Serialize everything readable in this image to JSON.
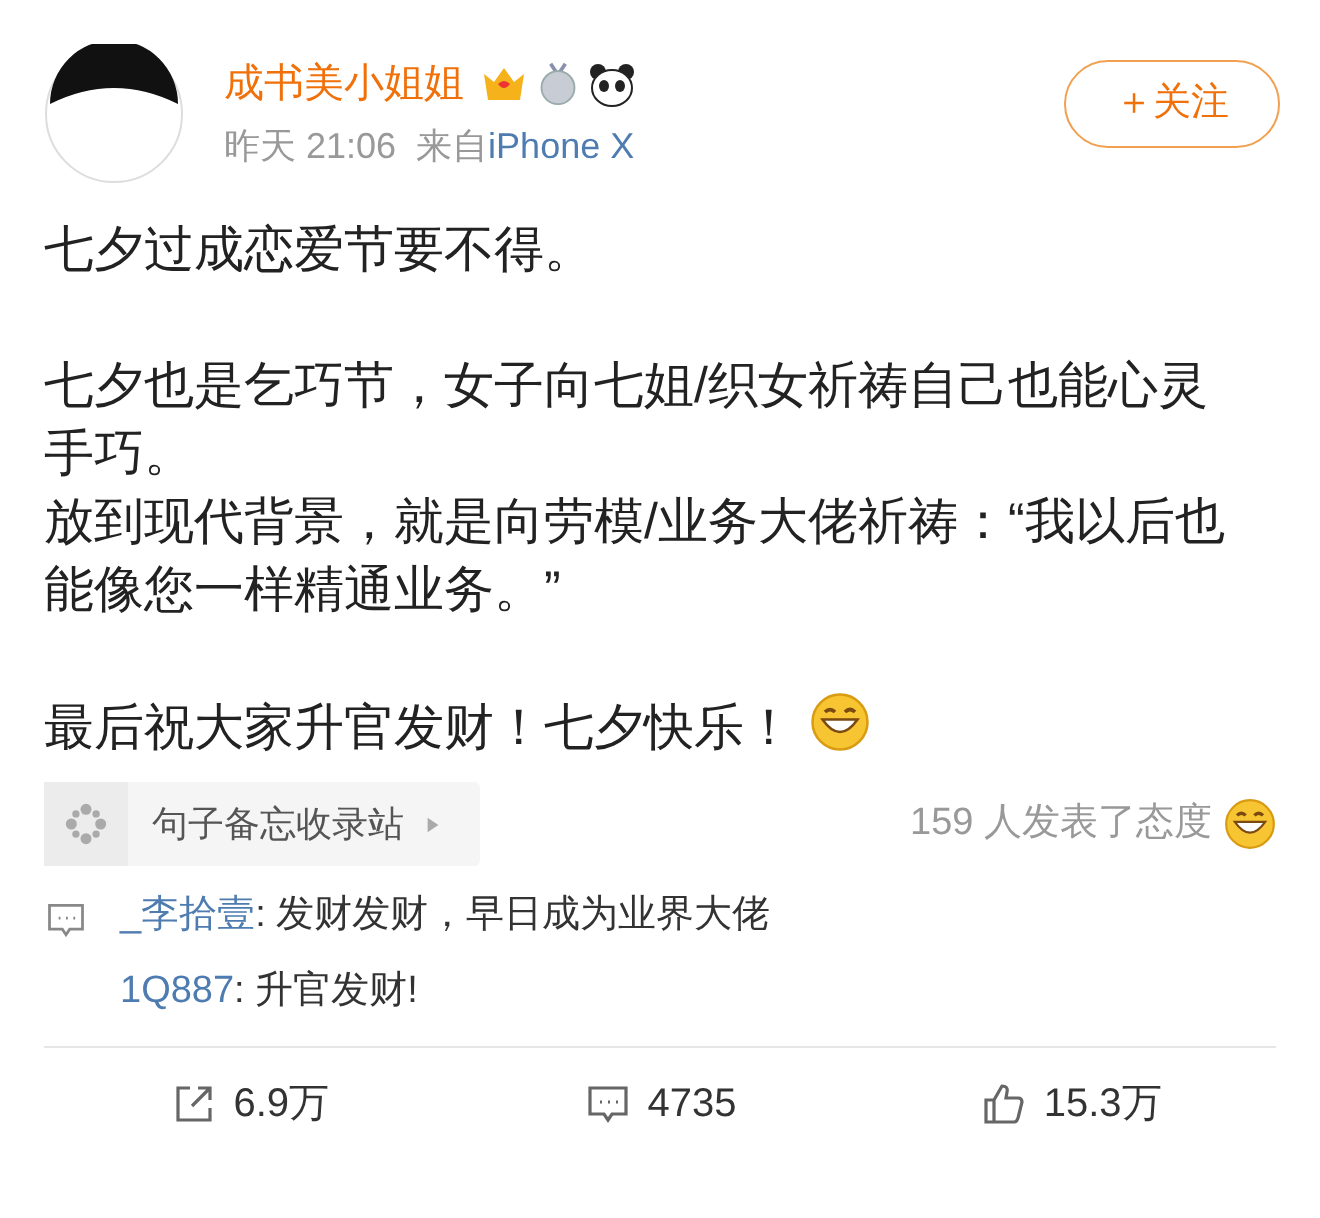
{
  "author": {
    "name": "成书美小姐姐",
    "time": "昨天 21:06",
    "source_prefix": "来自",
    "source": "iPhone X"
  },
  "follow_button": "＋关注",
  "body": [
    [
      "七夕过成恋爱节要不得。"
    ],
    [
      "七夕也是乞巧节，女子向七姐/织女祈祷自己也能心灵手巧。",
      "放到现代背景，就是向劳模/业务大佬祈祷：“我以后也能像您一样精通业务。”"
    ],
    [
      "最后祝大家升官发财！七夕快乐！"
    ]
  ],
  "topic_card": {
    "label": "句子备忘收录站"
  },
  "reactions": "159 人发表了态度",
  "comments": [
    {
      "user": "_李拾壹",
      "text": ": 发财发财，早日成为业界大佬"
    },
    {
      "user": "1Q887",
      "text": ": 升官发财!"
    }
  ],
  "actions": [
    {
      "kind": "repost",
      "count": "6.9万"
    },
    {
      "kind": "comment",
      "count": "4735"
    },
    {
      "kind": "like",
      "count": "15.3万"
    }
  ]
}
